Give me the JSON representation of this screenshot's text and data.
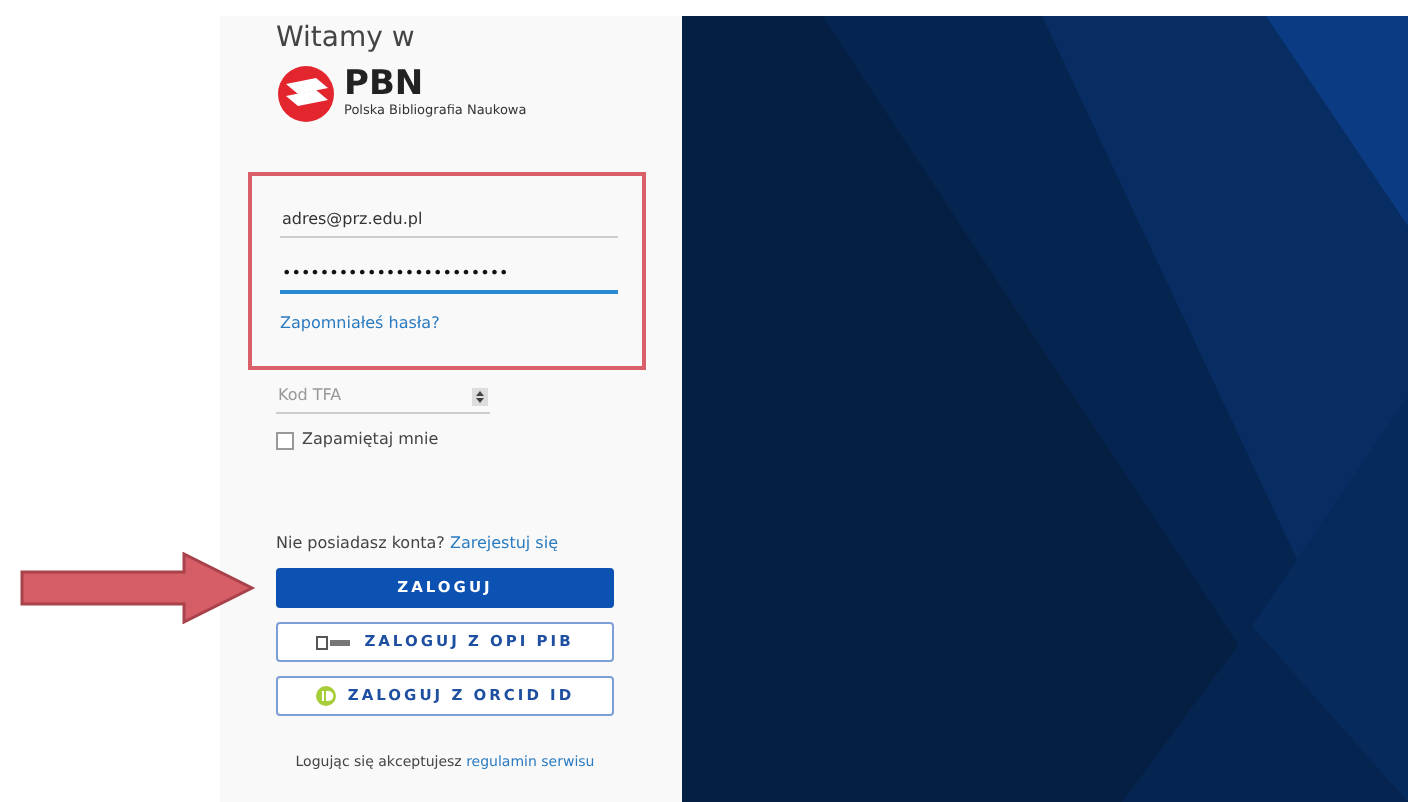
{
  "greeting": "Witamy w",
  "logo": {
    "title": "PBN",
    "subtitle": "Polska Bibliografia Naukowa"
  },
  "login_form": {
    "email": {
      "value": "adres@prz.edu.pl"
    },
    "password": {
      "value": "••••••••••••••••••••••••",
      "focused": true
    },
    "forgot_link": "Zapomniałeś hasła?"
  },
  "tfa": {
    "placeholder": "Kod TFA"
  },
  "remember": {
    "label": "Zapamiętaj mnie",
    "checked": false
  },
  "register": {
    "text": "Nie posiadasz konta?",
    "link": "Zarejestuj się"
  },
  "buttons": [
    {
      "label": "ZALOGUJ",
      "kind": "primary"
    },
    {
      "label": "ZALOGUJ Z OPI PIB",
      "kind": "opi"
    },
    {
      "label": "ZALOGUJ Z ORCID ID",
      "kind": "orcid"
    }
  ],
  "terms": {
    "text": "Logując się akceptujesz",
    "link": "regulamin serwisu"
  }
}
